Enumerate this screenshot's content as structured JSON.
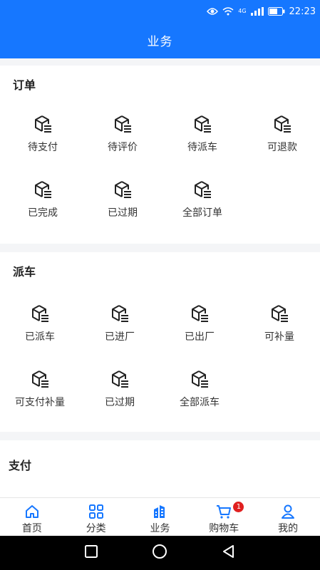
{
  "status_bar": {
    "signal_text": "4G",
    "time": "22:23"
  },
  "header": {
    "title": "业务"
  },
  "sections": {
    "order": {
      "title": "订单",
      "items": [
        {
          "label": "待支付",
          "icon": "package-icon"
        },
        {
          "label": "待评价",
          "icon": "package-icon"
        },
        {
          "label": "待派车",
          "icon": "package-icon"
        },
        {
          "label": "可退款",
          "icon": "package-icon"
        },
        {
          "label": "已完成",
          "icon": "package-icon"
        },
        {
          "label": "已过期",
          "icon": "package-icon"
        },
        {
          "label": "全部订单",
          "icon": "package-icon"
        }
      ]
    },
    "dispatch": {
      "title": "派车",
      "items": [
        {
          "label": "已派车",
          "icon": "package-icon"
        },
        {
          "label": "已进厂",
          "icon": "package-icon"
        },
        {
          "label": "已出厂",
          "icon": "package-icon"
        },
        {
          "label": "可补量",
          "icon": "package-icon"
        },
        {
          "label": "可支付补量",
          "icon": "package-icon"
        },
        {
          "label": "已过期",
          "icon": "package-icon"
        },
        {
          "label": "全部派车",
          "icon": "package-icon"
        }
      ]
    },
    "payment": {
      "title": "支付"
    }
  },
  "tabbar": {
    "items": [
      {
        "label": "首页",
        "icon": "home-icon"
      },
      {
        "label": "分类",
        "icon": "grid-icon"
      },
      {
        "label": "业务",
        "icon": "building-icon",
        "active": true
      },
      {
        "label": "购物车",
        "icon": "cart-icon",
        "badge": "1"
      },
      {
        "label": "我的",
        "icon": "user-icon"
      }
    ]
  },
  "colors": {
    "primary": "#1677ff",
    "badge": "#e02020",
    "text": "#333333"
  }
}
